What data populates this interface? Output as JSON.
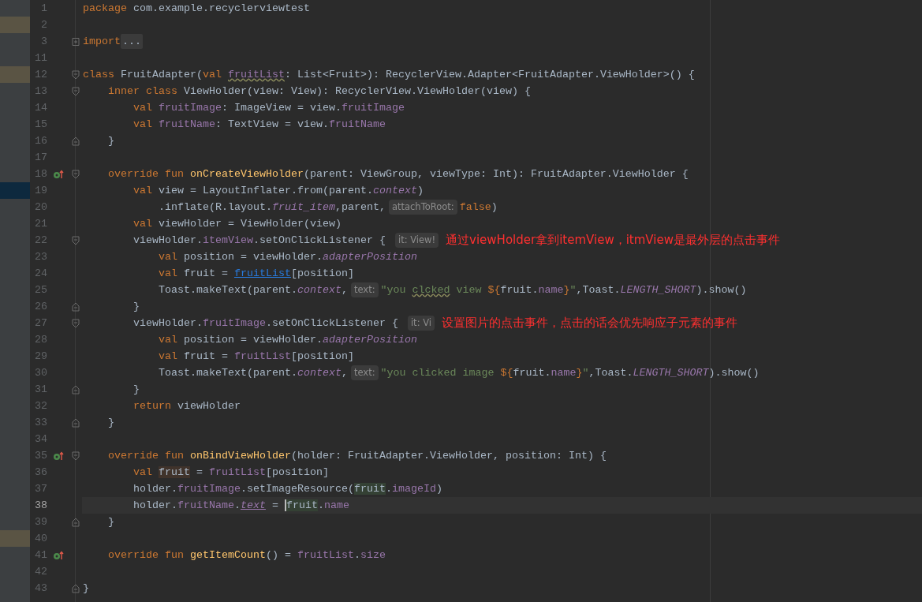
{
  "editor": {
    "lines": [
      {
        "number": "1",
        "tokens": [
          {
            "kind": "kw",
            "text": "package"
          },
          {
            "kind": "plain",
            "text": " com.example.recyclerviewtest"
          }
        ]
      },
      {
        "number": "2",
        "color": "#5a5444"
      },
      {
        "number": "3",
        "folded": true,
        "tokens": [
          {
            "kind": "kw",
            "text": "import"
          },
          {
            "kind": "folded",
            "text": "..."
          }
        ]
      },
      {
        "number": "11"
      },
      {
        "number": "12",
        "color": "#5a5444",
        "fold_start": true,
        "tokens": [
          {
            "kind": "kw",
            "text": "class"
          },
          {
            "kind": "plain",
            "text": " FruitAdapter("
          },
          {
            "kind": "kw",
            "text": "val "
          },
          {
            "kind": "prop-typo",
            "text": "fruitList"
          },
          {
            "kind": "plain",
            "text": ": List<Fruit>): RecyclerView.Adapter<FruitAdapter.ViewHolder>() {"
          }
        ]
      },
      {
        "number": "13",
        "fold_start": true,
        "tokens": [
          {
            "kind": "kw",
            "text": "    inner class"
          },
          {
            "kind": "plain",
            "text": " ViewHolder(view: View): RecyclerView.ViewHolder(view) {"
          }
        ]
      },
      {
        "number": "14",
        "tokens": [
          {
            "kind": "kw",
            "text": "        val "
          },
          {
            "kind": "prop",
            "text": "fruitImage"
          },
          {
            "kind": "plain",
            "text": ": ImageView = view."
          },
          {
            "kind": "prop",
            "text": "fruitImage"
          }
        ]
      },
      {
        "number": "15",
        "tokens": [
          {
            "kind": "kw",
            "text": "        val "
          },
          {
            "kind": "prop",
            "text": "fruitName"
          },
          {
            "kind": "plain",
            "text": ": TextView = view."
          },
          {
            "kind": "prop",
            "text": "fruitName"
          }
        ]
      },
      {
        "number": "16",
        "fold_end": true,
        "tokens": [
          {
            "kind": "plain",
            "text": "    }"
          }
        ]
      },
      {
        "number": "17"
      },
      {
        "number": "18",
        "override": true,
        "fold_start": true,
        "tokens": [
          {
            "kind": "kw",
            "text": "    override fun "
          },
          {
            "kind": "fn",
            "text": "onCreateViewHolder"
          },
          {
            "kind": "plain",
            "text": "(parent: ViewGroup, viewType: Int): FruitAdapter.ViewHolder {"
          }
        ]
      },
      {
        "number": "19",
        "color": "#0d293e",
        "tokens": [
          {
            "kind": "kw",
            "text": "        val"
          },
          {
            "kind": "plain",
            "text": " view = LayoutInflater.from(parent."
          },
          {
            "kind": "prop-italic",
            "text": "context"
          },
          {
            "kind": "plain",
            "text": ")"
          }
        ]
      },
      {
        "number": "20",
        "tokens": [
          {
            "kind": "plain",
            "text": "            .inflate(R.layout."
          },
          {
            "kind": "prop-italic",
            "text": "fruit_item"
          },
          {
            "kind": "plain",
            "text": ",parent,"
          },
          {
            "kind": "hint",
            "text": "attachToRoot:"
          },
          {
            "kind": "kw",
            "text": "false"
          },
          {
            "kind": "plain",
            "text": ")"
          }
        ]
      },
      {
        "number": "21",
        "tokens": [
          {
            "kind": "kw",
            "text": "        val"
          },
          {
            "kind": "plain",
            "text": " viewHolder = ViewHolder(view)"
          }
        ]
      },
      {
        "number": "22",
        "fold_start": true,
        "tokens": [
          {
            "kind": "plain",
            "text": "        viewHolder."
          },
          {
            "kind": "prop",
            "text": "itemView"
          },
          {
            "kind": "plain",
            "text": ".setOnClickListener { "
          },
          {
            "kind": "hint",
            "text": "it: View!"
          }
        ],
        "annotation": "通过viewHolder拿到itemView，itmView是最外层的点击事件"
      },
      {
        "number": "23",
        "tokens": [
          {
            "kind": "kw",
            "text": "            val"
          },
          {
            "kind": "plain",
            "text": " position = viewHolder."
          },
          {
            "kind": "prop-italic",
            "text": "adapterPosition"
          }
        ]
      },
      {
        "number": "24",
        "tokens": [
          {
            "kind": "kw",
            "text": "            val"
          },
          {
            "kind": "plain",
            "text": " fruit = "
          },
          {
            "kind": "link",
            "text": "fruitList"
          },
          {
            "kind": "plain",
            "text": "[position]"
          }
        ]
      },
      {
        "number": "25",
        "tokens": [
          {
            "kind": "plain",
            "text": "            Toast.makeText(parent."
          },
          {
            "kind": "prop-italic",
            "text": "context"
          },
          {
            "kind": "plain",
            "text": ","
          },
          {
            "kind": "hint",
            "text": "text:"
          },
          {
            "kind": "str",
            "text": "\"you "
          },
          {
            "kind": "str-typo",
            "text": "clcked"
          },
          {
            "kind": "str",
            "text": " view "
          },
          {
            "kind": "kw",
            "text": "${"
          },
          {
            "kind": "plain",
            "text": "fruit."
          },
          {
            "kind": "prop",
            "text": "name"
          },
          {
            "kind": "kw",
            "text": "}"
          },
          {
            "kind": "str",
            "text": "\""
          },
          {
            "kind": "plain",
            "text": ",Toast."
          },
          {
            "kind": "prop-italic",
            "text": "LENGTH_SHORT"
          },
          {
            "kind": "plain",
            "text": ").show()"
          }
        ]
      },
      {
        "number": "26",
        "fold_end": true,
        "tokens": [
          {
            "kind": "plain",
            "text": "        }"
          }
        ]
      },
      {
        "number": "27",
        "fold_start": true,
        "tokens": [
          {
            "kind": "plain",
            "text": "        viewHolder."
          },
          {
            "kind": "prop",
            "text": "fruitImage"
          },
          {
            "kind": "plain",
            "text": ".setOnClickListener { "
          },
          {
            "kind": "hint",
            "text": "it: Vi"
          }
        ],
        "annotation": "设置图片的点击事件，点击的话会优先响应子元素的事件"
      },
      {
        "number": "28",
        "tokens": [
          {
            "kind": "kw",
            "text": "            val"
          },
          {
            "kind": "plain",
            "text": " position = viewHolder."
          },
          {
            "kind": "prop-italic",
            "text": "adapterPosition"
          }
        ]
      },
      {
        "number": "29",
        "tokens": [
          {
            "kind": "kw",
            "text": "            val"
          },
          {
            "kind": "plain",
            "text": " fruit = "
          },
          {
            "kind": "prop",
            "text": "fruitList"
          },
          {
            "kind": "plain",
            "text": "[position]"
          }
        ]
      },
      {
        "number": "30",
        "tokens": [
          {
            "kind": "plain",
            "text": "            Toast.makeText(parent."
          },
          {
            "kind": "prop-italic",
            "text": "context"
          },
          {
            "kind": "plain",
            "text": ","
          },
          {
            "kind": "hint",
            "text": "text:"
          },
          {
            "kind": "str",
            "text": "\"you clicked image "
          },
          {
            "kind": "kw",
            "text": "${"
          },
          {
            "kind": "plain",
            "text": "fruit."
          },
          {
            "kind": "prop",
            "text": "name"
          },
          {
            "kind": "kw",
            "text": "}"
          },
          {
            "kind": "str",
            "text": "\""
          },
          {
            "kind": "plain",
            "text": ",Toast."
          },
          {
            "kind": "prop-italic",
            "text": "LENGTH_SHORT"
          },
          {
            "kind": "plain",
            "text": ").show()"
          }
        ]
      },
      {
        "number": "31",
        "fold_end": true,
        "tokens": [
          {
            "kind": "plain",
            "text": "        }"
          }
        ]
      },
      {
        "number": "32",
        "tokens": [
          {
            "kind": "kw",
            "text": "        return"
          },
          {
            "kind": "plain",
            "text": " viewHolder"
          }
        ]
      },
      {
        "number": "33",
        "fold_end": true,
        "tokens": [
          {
            "kind": "plain",
            "text": "    }"
          }
        ]
      },
      {
        "number": "34"
      },
      {
        "number": "35",
        "override": true,
        "fold_start": true,
        "tokens": [
          {
            "kind": "kw",
            "text": "    override fun "
          },
          {
            "kind": "fn",
            "text": "onBindViewHolder"
          },
          {
            "kind": "plain",
            "text": "(holder: FruitAdapter.ViewHolder, position: Int) {"
          }
        ]
      },
      {
        "number": "36",
        "tokens": [
          {
            "kind": "kw",
            "text": "        val "
          },
          {
            "kind": "usage-write",
            "text": "fruit"
          },
          {
            "kind": "plain",
            "text": " = "
          },
          {
            "kind": "prop",
            "text": "fruitList"
          },
          {
            "kind": "plain",
            "text": "[position]"
          }
        ]
      },
      {
        "number": "37",
        "tokens": [
          {
            "kind": "plain",
            "text": "        holder."
          },
          {
            "kind": "prop",
            "text": "fruitImage"
          },
          {
            "kind": "plain",
            "text": ".setImageResource("
          },
          {
            "kind": "usage-read",
            "text": "fruit"
          },
          {
            "kind": "plain",
            "text": "."
          },
          {
            "kind": "prop",
            "text": "imageId"
          },
          {
            "kind": "plain",
            "text": ")"
          }
        ]
      },
      {
        "number": "38",
        "current": true,
        "tokens": [
          {
            "kind": "plain",
            "text": "        holder."
          },
          {
            "kind": "prop",
            "text": "fruitName"
          },
          {
            "kind": "plain",
            "text": "."
          },
          {
            "kind": "prop-italic-underline",
            "text": "text"
          },
          {
            "kind": "plain",
            "text": " = "
          },
          {
            "kind": "usage-read",
            "text": "fruit",
            "caret": true
          },
          {
            "kind": "plain",
            "text": "."
          },
          {
            "kind": "prop",
            "text": "name"
          }
        ]
      },
      {
        "number": "39",
        "fold_end": true,
        "tokens": [
          {
            "kind": "plain",
            "text": "    }"
          }
        ]
      },
      {
        "number": "40",
        "color": "#5a5444"
      },
      {
        "number": "41",
        "override": true,
        "tokens": [
          {
            "kind": "kw",
            "text": "    override fun "
          },
          {
            "kind": "fn",
            "text": "getItemCount"
          },
          {
            "kind": "plain",
            "text": "() = "
          },
          {
            "kind": "prop",
            "text": "fruitList"
          },
          {
            "kind": "plain",
            "text": "."
          },
          {
            "kind": "prop",
            "text": "size"
          }
        ]
      },
      {
        "number": "42"
      },
      {
        "number": "43",
        "fold_end": true,
        "tokens": [
          {
            "kind": "plain",
            "text": "}"
          }
        ]
      }
    ]
  }
}
